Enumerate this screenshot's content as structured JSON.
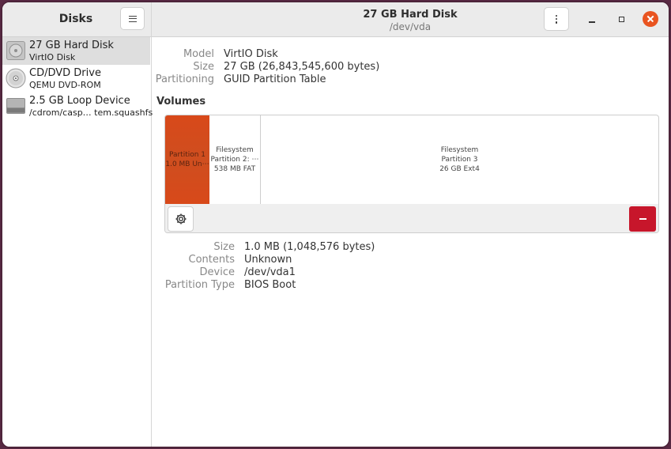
{
  "sidebar": {
    "title": "Disks",
    "menu_icon": "hamburger-icon",
    "devices": [
      {
        "name": "27 GB Hard Disk",
        "sub": "VirtIO Disk",
        "icon": "hard-disk-icon",
        "selected": true
      },
      {
        "name": "CD/DVD Drive",
        "sub": "QEMU DVD-ROM",
        "icon": "optical-disc-icon",
        "selected": false
      },
      {
        "name": "2.5 GB Loop Device",
        "sub": "/cdrom/casp… tem.squashfs",
        "icon": "loop-device-icon",
        "selected": false
      }
    ]
  },
  "header": {
    "title": "27 GB Hard Disk",
    "subtitle": "/dev/vda",
    "menu_icon": "kebab-menu-icon",
    "controls": [
      "minimize-icon",
      "maximize-icon",
      "close-icon"
    ]
  },
  "disk": {
    "model_label": "Model",
    "model_value": "VirtIO Disk",
    "size_label": "Size",
    "size_value": "27 GB (26,843,545,600 bytes)",
    "partitioning_label": "Partitioning",
    "partitioning_value": "GUID Partition Table"
  },
  "volumes": {
    "title": "Volumes",
    "partitions": [
      {
        "lines": [
          "Partition 1",
          "1.0 MB Un⋯"
        ],
        "selected": true
      },
      {
        "lines": [
          "Filesystem",
          "Partition 2: ⋯",
          "538 MB FAT"
        ],
        "selected": false
      },
      {
        "lines": [
          "Filesystem",
          "Partition 3",
          "26 GB Ext4"
        ],
        "selected": false
      }
    ]
  },
  "partition_details": {
    "size_label": "Size",
    "size_value": "1.0 MB (1,048,576 bytes)",
    "contents_label": "Contents",
    "contents_value": "Unknown",
    "device_label": "Device",
    "device_value": "/dev/vda1",
    "type_label": "Partition Type",
    "type_value": "BIOS Boot"
  },
  "colors": {
    "accent": "#e95420",
    "selected_partition": "#d8491a",
    "destructive": "#c7162b"
  }
}
